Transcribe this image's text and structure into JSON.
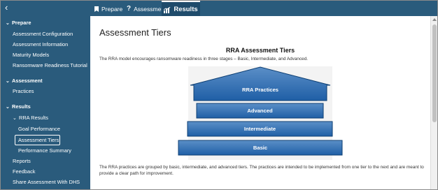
{
  "topbar": {
    "back_icon": "chevron-left",
    "tabs": [
      {
        "label": "Prepare",
        "icon": "bookmark-icon"
      },
      {
        "label": "Assessment",
        "icon": "question-icon"
      },
      {
        "label": "Results",
        "icon": "bar-chart-icon",
        "active": true
      }
    ]
  },
  "sidebar": {
    "sections": [
      {
        "label": "Prepare",
        "items": [
          "Assessment Configuration",
          "Assessment Information",
          "Maturity Models",
          "Ransomware Readiness Tutorial"
        ]
      },
      {
        "label": "Assessment",
        "items": [
          "Practices"
        ]
      },
      {
        "label": "Results",
        "subsection": "RRA Results",
        "subitems": [
          "Goal Performance",
          "Assessment Tiers",
          "Performance Summary"
        ],
        "items": [
          "Reports",
          "Feedback",
          "Share Assessment With DHS"
        ]
      }
    ],
    "active_item": "Assessment Tiers"
  },
  "main": {
    "page_title": "Assessment Tiers",
    "figure_title": "RRA Assessment Tiers",
    "intro": "The RRA model encourages ransomware readiness in three stages – Basic, Intermediate, and Advanced.",
    "tiers": [
      "RRA Practices",
      "Advanced",
      "Intermediate",
      "Basic"
    ],
    "bottom_text": "The RRA practices are grouped by basic, intermediate, and advanced tiers. The practices are intended to be implemented from one tier to the next and are meant to provide a clear path for improvement."
  },
  "colors": {
    "sidebar_bg": "#2a5b7c",
    "tier_top": "#5b8fc7",
    "tier_bottom": "#1f5fa6",
    "tier_border": "#0e3f73"
  }
}
